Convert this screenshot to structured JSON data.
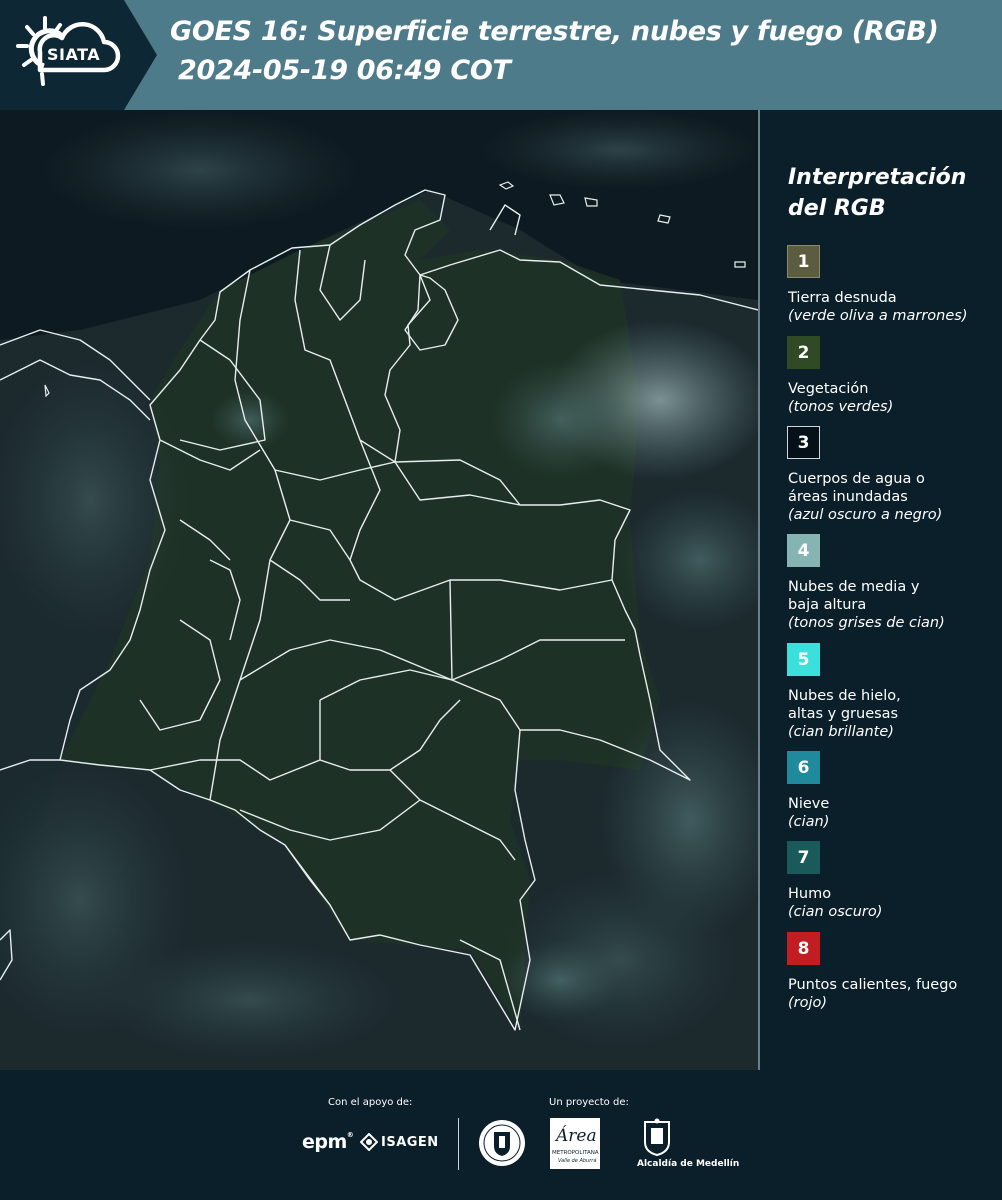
{
  "header": {
    "logo_text": "SIATA",
    "title_line1": "GOES 16: Superficie terrestre, nubes y fuego (RGB)",
    "title_line2": "2024-05-19 06:49 COT"
  },
  "legend": {
    "title_line1": "Interpretación",
    "title_line2": "del RGB",
    "items": [
      {
        "num": "1",
        "color": "#5c5d40",
        "text_color": "#ffffff",
        "lines": [
          "Tierra desnuda"
        ],
        "note": "(verde oliva a marrones)"
      },
      {
        "num": "2",
        "color": "#2f4a25",
        "text_color": "#ffffff",
        "lines": [
          "Vegetación"
        ],
        "note": "(tonos verdes)"
      },
      {
        "num": "3",
        "color": "#061018",
        "text_color": "#ffffff",
        "lines": [
          "Cuerpos de agua o",
          "áreas inundadas"
        ],
        "note": "(azul oscuro a negro)"
      },
      {
        "num": "4",
        "color": "#86b4b2",
        "text_color": "#ffffff",
        "lines": [
          "Nubes de media y",
          "baja altura"
        ],
        "note": "(tonos grises de cian)"
      },
      {
        "num": "5",
        "color": "#3be0dc",
        "text_color": "#ffffff",
        "lines": [
          "Nubes de hielo,",
          "altas y gruesas"
        ],
        "note": "(cian brillante)"
      },
      {
        "num": "6",
        "color": "#1f8a9c",
        "text_color": "#ffffff",
        "lines": [
          "Nieve"
        ],
        "note": "(cian)"
      },
      {
        "num": "7",
        "color": "#1a5a5a",
        "text_color": "#ffffff",
        "lines": [
          "Humo"
        ],
        "note": "(cian oscuro)"
      },
      {
        "num": "8",
        "color": "#c21d22",
        "text_color": "#ffffff",
        "lines": [
          "Puntos calientes, fuego"
        ],
        "note": "(rojo)"
      }
    ]
  },
  "footer": {
    "support_label": "Con el apoyo de:",
    "project_label": "Un proyecto de:",
    "logo_epm": "epm",
    "logo_isagen": "ISAGEN",
    "logo_area_script": "Área",
    "logo_area_line1": "METROPOLITANA",
    "logo_area_line2": "Valle de Aburrá",
    "logo_medellin": "Alcaldía de Medellín"
  }
}
